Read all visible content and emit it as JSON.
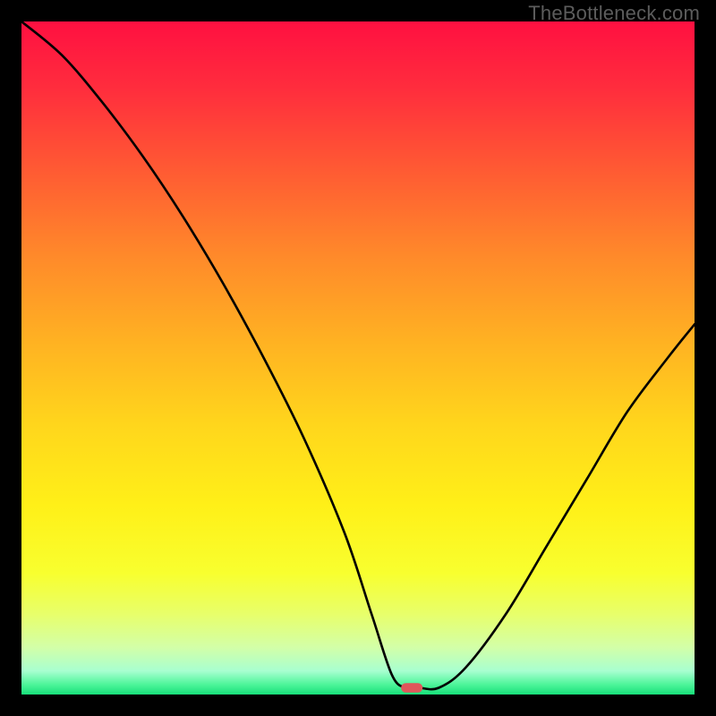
{
  "watermark": "TheBottleneck.com",
  "chart_data": {
    "type": "line",
    "title": "",
    "xlabel": "",
    "ylabel": "",
    "xlim": [
      0,
      100
    ],
    "ylim": [
      0,
      100
    ],
    "x": [
      0,
      6,
      12,
      18,
      24,
      30,
      36,
      42,
      48,
      52,
      55,
      57,
      59,
      62,
      66,
      72,
      78,
      84,
      90,
      96,
      100
    ],
    "values": [
      100,
      95,
      88,
      80,
      71,
      61,
      50,
      38,
      24,
      12,
      3,
      1,
      1,
      1,
      4,
      12,
      22,
      32,
      42,
      50,
      55
    ],
    "optimum_x": 58,
    "gradient_stops": [
      {
        "offset": 0.0,
        "color": "#ff1041"
      },
      {
        "offset": 0.1,
        "color": "#ff2d3d"
      },
      {
        "offset": 0.22,
        "color": "#ff5a33"
      },
      {
        "offset": 0.35,
        "color": "#ff8a2a"
      },
      {
        "offset": 0.48,
        "color": "#ffb322"
      },
      {
        "offset": 0.6,
        "color": "#ffd61c"
      },
      {
        "offset": 0.72,
        "color": "#fff018"
      },
      {
        "offset": 0.82,
        "color": "#f8ff2f"
      },
      {
        "offset": 0.88,
        "color": "#e8ff6a"
      },
      {
        "offset": 0.93,
        "color": "#d3ffa8"
      },
      {
        "offset": 0.965,
        "color": "#a8ffd0"
      },
      {
        "offset": 0.985,
        "color": "#4ef59a"
      },
      {
        "offset": 1.0,
        "color": "#18e07a"
      }
    ],
    "marker": {
      "width": 3.2,
      "height": 1.4,
      "color": "#e0575a"
    }
  }
}
